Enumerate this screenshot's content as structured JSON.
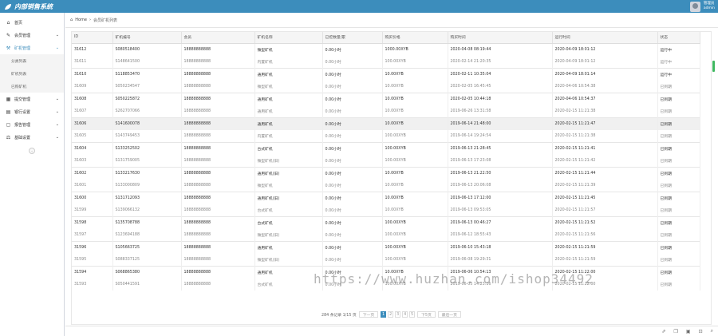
{
  "app": {
    "title": "内部销售系统"
  },
  "user": {
    "role": "管理员",
    "name": "admin"
  },
  "sidebar": {
    "items": [
      {
        "icon": "home-icon",
        "glyph": "⌂",
        "label": "首页",
        "chevron": false
      },
      {
        "icon": "edit-icon",
        "glyph": "✎",
        "label": "会员管理",
        "chevron": true
      },
      {
        "icon": "robot-icon",
        "glyph": "⚒",
        "label": "矿机管理",
        "chevron": true,
        "open": true,
        "children": [
          "分类列表",
          "矿机列表",
          "已购矿机"
        ]
      },
      {
        "icon": "calendar-icon",
        "glyph": "▦",
        "label": "提交管理",
        "chevron": true
      },
      {
        "icon": "bank-icon",
        "glyph": "▤",
        "label": "银行设置",
        "chevron": true
      },
      {
        "icon": "document-icon",
        "glyph": "▢",
        "label": "报告管理",
        "chevron": true
      },
      {
        "icon": "scale-icon",
        "glyph": "⚖",
        "label": "基础设置",
        "chevron": true
      }
    ],
    "collapse_glyph": "‹"
  },
  "breadcrumb": {
    "home": "Home",
    "sep": "›",
    "current": "会员矿机列表"
  },
  "table": {
    "columns": [
      "ID",
      "矿机编号",
      "会员",
      "矿机名称",
      "已挖数量/累",
      "购买价格",
      "购买时间",
      "运行时间",
      "状态"
    ],
    "rows": [
      [
        "31612",
        "S080518400",
        "18888888888",
        "微型矿机",
        "0.00小时",
        "1000.00XYB",
        "2020-04-08 08:19:44",
        "2020-04-09 18:01:12",
        "运行中"
      ],
      [
        "31611",
        "S148641500",
        "18888888888",
        "内置矿机",
        "0.00小时",
        "100.00XYB",
        "2020-02-14 21:20:35",
        "2020-04-09 18:01:12",
        "运行中"
      ],
      [
        "31610",
        "S118853470",
        "18888888888",
        "通用矿机",
        "0.00小时",
        "10.00XYB",
        "2020-02-11 10:35:04",
        "2020-04-09 18:01:14",
        "运行中"
      ],
      [
        "31609",
        "S050234547",
        "18888888888",
        "微型矿机",
        "0.00小时",
        "10.00XYB",
        "2020-02-05 16:45:45",
        "2020-04-06 10:54:38",
        "已到期"
      ],
      [
        "31608",
        "S050225872",
        "18888888888",
        "通用矿机",
        "0.00小时",
        "10.00XYB",
        "2020-02-05 10:44:18",
        "2020-04-06 10:54:37",
        "已到期"
      ],
      [
        "31607",
        "S262707066",
        "18888888888",
        "通用矿机",
        "0.00小时",
        "10.00XYB",
        "2019-06-26 13:31:58",
        "2020-02-15 11:21:38",
        "已到期"
      ],
      [
        "31606",
        "S141600078",
        "18888888888",
        "通用矿机",
        "0.00小时",
        "10.00XYB",
        "2019-06-14 21:48:00",
        "2020-02-15 11:21:47",
        "已到期"
      ],
      [
        "31605",
        "S143749453",
        "18888888888",
        "内置矿机",
        "0.00小时",
        "100.00XYB",
        "2019-06-14 19:24:54",
        "2020-02-15 11:21:38",
        "已到期"
      ],
      [
        "31604",
        "S133252502",
        "18888888888",
        "台式矿机",
        "0.00小时",
        "100.00XYB",
        "2019-06-13 21:28:45",
        "2020-02-15 11:21:41",
        "已到期"
      ],
      [
        "31603",
        "S131759005",
        "18888888888",
        "微型矿机(旧)",
        "0.00小时",
        "100.00XYB",
        "2019-06-13 17:23:08",
        "2020-02-15 11:21:42",
        "已到期"
      ],
      [
        "31602",
        "S133217630",
        "18888888888",
        "通用矿机(旧)",
        "0.00小时",
        "10.00XYB",
        "2019-06-13 21:22:50",
        "2020-02-15 11:21:44",
        "已到期"
      ],
      [
        "31601",
        "S133000809",
        "18888888888",
        "微型矿机",
        "0.00小时",
        "10.00XYB",
        "2019-06-13 20:06:08",
        "2020-02-15 11:21:39",
        "已到期"
      ],
      [
        "31600",
        "S131712093",
        "18888888888",
        "通用矿机(旧)",
        "0.00小时",
        "10.00XYB",
        "2019-06-13 17:12:00",
        "2020-02-15 11:21:45",
        "已到期"
      ],
      [
        "31599",
        "S139066132",
        "18888888888",
        "台式矿机",
        "0.00小时",
        "10.00XYB",
        "2019-06-13 09:53:05",
        "2020-02-15 11:21:57",
        "已到期"
      ],
      [
        "31598",
        "S135708788",
        "18888888888",
        "台式矿机",
        "0.00小时",
        "100.00XYB",
        "2019-06-13 00:46:27",
        "2020-02-15 11:21:52",
        "已到期"
      ],
      [
        "31597",
        "S123694188",
        "18888888888",
        "微型矿机(旧)",
        "0.00小时",
        "100.00XYB",
        "2019-06-12 18:55:43",
        "2020-02-15 11:21:56",
        "已到期"
      ],
      [
        "31596",
        "S105663725",
        "18888888888",
        "通用矿机",
        "0.00小时",
        "100.00XYB",
        "2019-06-10 15:43:18",
        "2020-02-15 11:21:59",
        "已到期"
      ],
      [
        "31595",
        "S088337125",
        "18888888888",
        "微型矿机(旧)",
        "0.00小时",
        "100.00XYB",
        "2019-06-08 19:29:31",
        "2020-02-15 11:21:59",
        "已到期"
      ],
      [
        "31594",
        "S068865380",
        "18888888888",
        "通用矿机",
        "0.00小时",
        "10.00XYB",
        "2019-06-06 10:54:13",
        "2020-02-15 11:22:00",
        "已到期"
      ],
      [
        "31593",
        "S050441591",
        "18888888888",
        "台式矿机",
        "0.00小时",
        "100.00XYB",
        "2019-06-05 14:23:16",
        "2020-02-15 11:22:00",
        "已到期"
      ]
    ]
  },
  "pager": {
    "summary": "284 条记录 1/15 页",
    "prev": "下一页",
    "pages": [
      "1",
      "2",
      "3",
      "4",
      "5"
    ],
    "next": "下5页",
    "last": "最后一页"
  },
  "watermark": "https://www.huzhan.com/ishop34492",
  "footer": {
    "icons": [
      "share-icon",
      "copy-icon",
      "window-icon",
      "fullscreen-icon",
      "search-icon"
    ]
  },
  "colors": {
    "topbar": "#3c8dbc",
    "accent": "#3c8dbc",
    "scrollbar": "#3fb860"
  }
}
